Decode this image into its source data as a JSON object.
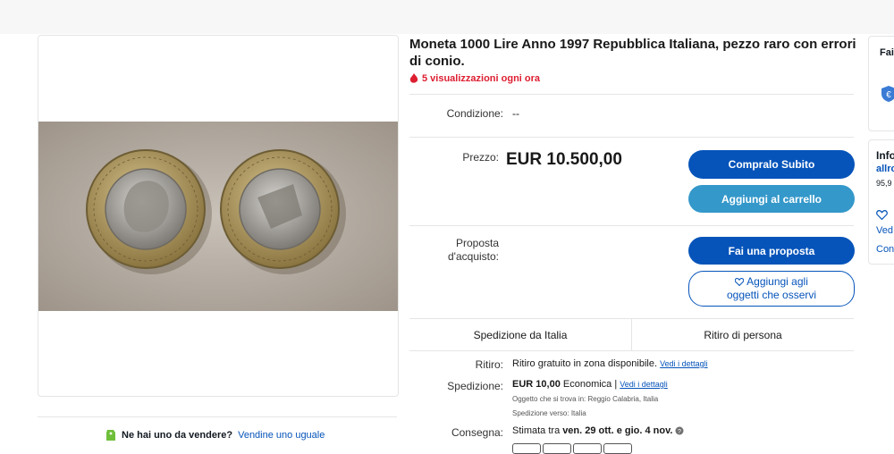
{
  "listing": {
    "title": "Moneta 1000 Lire Anno 1997 Repubblica Italiana, pezzo raro con errori di conio.",
    "views": "5 visualizzazioni ogni ora"
  },
  "condition": {
    "label": "Condizione:",
    "value": "--"
  },
  "price": {
    "label": "Prezzo:",
    "value": "EUR 10.500,00"
  },
  "buttons": {
    "buy_now": "Compralo Subito",
    "add_to_cart": "Aggiungi al carrello",
    "make_offer": "Fai una proposta",
    "watch_line1": "Aggiungi agli",
    "watch_line2": "oggetti che osservi"
  },
  "offer": {
    "label_line1": "Proposta",
    "label_line2": "d'acquisto:"
  },
  "tabs": {
    "shipping": "Spedizione da Italia",
    "pickup": "Ritiro di persona"
  },
  "pickup_row": {
    "label": "Ritiro:",
    "value": "Ritiro gratuito in zona disponibile.",
    "link": "Vedi i dettagli"
  },
  "shipping_row": {
    "label": "Spedizione:",
    "price": "EUR 10,00",
    "service": "Economica |",
    "link": "Vedi i dettagli",
    "location_label": "Oggetto che si trova in:",
    "location_value": "Reggio Calabria, Italia",
    "dest_label": "Spedizione verso:",
    "dest_value": "Italia"
  },
  "delivery_row": {
    "label": "Consegna:",
    "prefix": "Stimata tra",
    "dates": "ven. 29 ott. e gio. 4 nov."
  },
  "sell": {
    "question": "Ne hai uno da vendere?",
    "link": "Vendine uno uguale"
  },
  "right_panel": {
    "card1_title": "Fai",
    "card2_title": "Info",
    "seller": "allro",
    "feedback": "95,9",
    "save": "Ved",
    "contact": "Con"
  },
  "colors": {
    "accent": "#0654ba",
    "secondary": "#3498ca",
    "alert": "#dd1e31"
  }
}
